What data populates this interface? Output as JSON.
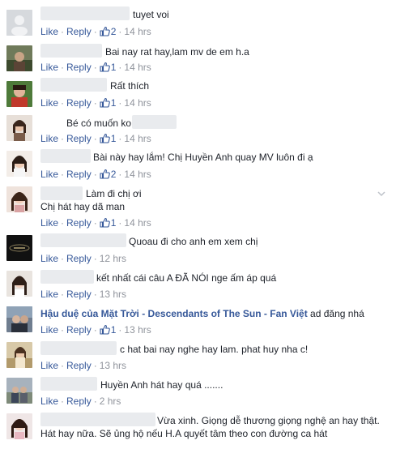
{
  "actions": {
    "like": "Like",
    "reply": "Reply",
    "separator": "·"
  },
  "colors": {
    "link": "#365899",
    "meta": "#90949c",
    "blur": "#e9ebee",
    "text": "#1d2129"
  },
  "comments": [
    {
      "text": "tuyet voi",
      "likes": "2",
      "time": "14 hrs"
    },
    {
      "text": "Bai nay rat hay,lam mv de em h.a",
      "likes": "1",
      "time": "14 hrs"
    },
    {
      "text": "Rất thích",
      "likes": "1",
      "time": "14 hrs"
    },
    {
      "text": "Bé có muốn ko",
      "likes": "1",
      "time": "14 hrs"
    },
    {
      "text": "Bài này hay lắm! Chị Huyền Anh quay MV luôn đi ạ",
      "likes": "2",
      "time": "14 hrs"
    },
    {
      "text": "Làm đi chị ơi",
      "text2": "Chị hát hay dã man",
      "likes": "1",
      "time": "14 hrs"
    },
    {
      "text": "Quoau đi cho anh em xem chị",
      "time": "12 hrs"
    },
    {
      "text": "kết nhất cái câu A ĐÃ NÓI nge ấm áp quá",
      "time": "13 hrs"
    },
    {
      "name": "Hậu duệ của Mặt Trời - Descendants of The Sun - Fan Việt",
      "text": "ad đăng nhá",
      "likes": "1",
      "time": "13 hrs"
    },
    {
      "text": "c hat bai nay nghe hay lam. phat huy nha c!",
      "time": "13 hrs"
    },
    {
      "text": "Huyền Anh hát hay quá .......",
      "time": "2 hrs"
    },
    {
      "text": "Vừa xinh. Giọng dễ thương giọng nghệ an hay thật.",
      "text2": "Hát hay nữa. Sẽ ủng hộ nếu H.A quyết tâm theo con đường ca hát"
    }
  ]
}
